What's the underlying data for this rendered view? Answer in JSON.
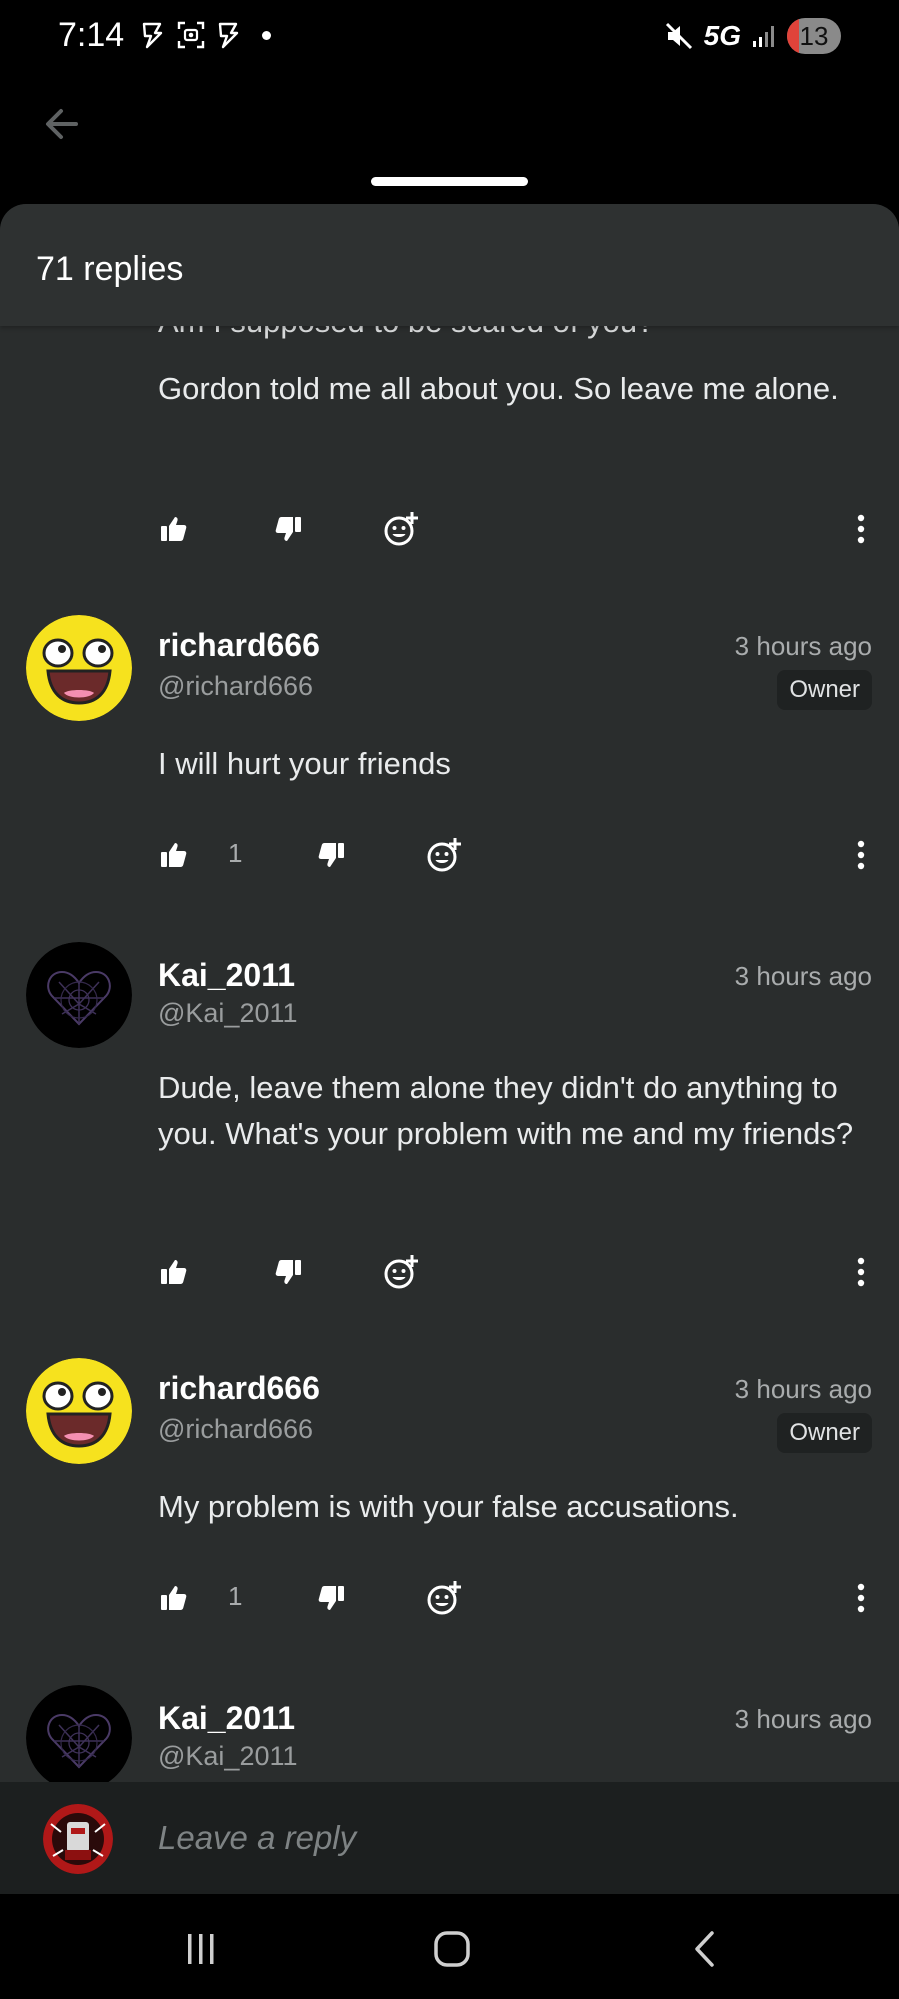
{
  "status_bar": {
    "time": "7:14",
    "network": "5G",
    "battery": "13"
  },
  "sheet": {
    "title": "71 replies"
  },
  "cut_off_text": "Am I supposed to be scared of you?",
  "comments": [
    {
      "body": "Gordon told me all about you. So leave me alone.",
      "likes": ""
    },
    {
      "username": "richard666",
      "handle": "@richard666",
      "time": "3 hours ago",
      "badge": "Owner",
      "body": "I will hurt your friends",
      "likes": "1"
    },
    {
      "username": "Kai_2011",
      "handle": "@Kai_2011",
      "time": "3 hours ago",
      "body": "Dude, leave them alone they didn't do anything to you. What's your problem with me and my friends?",
      "likes": ""
    },
    {
      "username": "richard666",
      "handle": "@richard666",
      "time": "3 hours ago",
      "badge": "Owner",
      "body": "My problem is with your false accusations.",
      "likes": "1"
    },
    {
      "username": "Kai_2011",
      "handle": "@Kai_2011",
      "time": "3 hours ago"
    }
  ],
  "reply": {
    "placeholder": "Leave a reply"
  },
  "colors": {
    "sheet_bg": "#2a2d2d",
    "header_bg": "#2e3131",
    "reply_bar_bg": "#1c1f1f",
    "text": "#e9ebec",
    "muted": "#a9acad",
    "avatar_yellow": "#f6e21e"
  },
  "icons": {
    "back": "arrow-left-icon",
    "like": "thumbs-up-icon",
    "dislike": "thumbs-down-icon",
    "emoji": "add-reaction-icon",
    "more": "more-vertical-icon",
    "nav_recents": "recents-icon",
    "nav_home": "home-icon",
    "nav_back": "nav-back-icon"
  }
}
